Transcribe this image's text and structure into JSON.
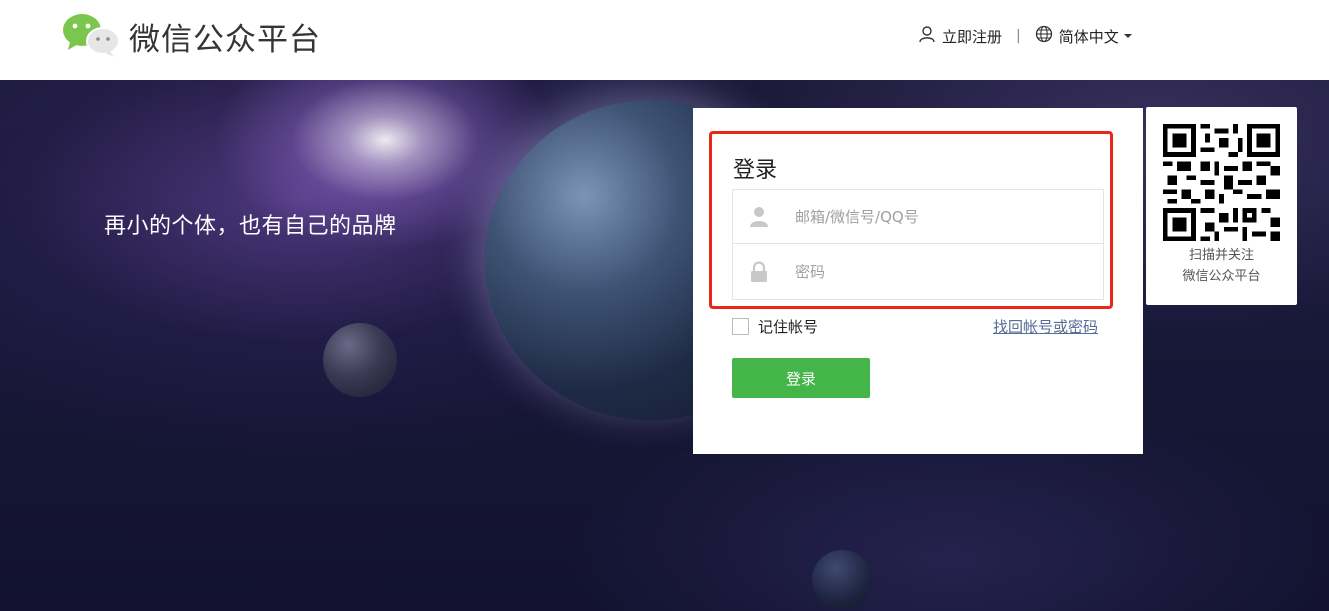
{
  "header": {
    "brand": "微信公众平台",
    "register_label": "立即注册",
    "separator": "|",
    "language_label": "简体中文"
  },
  "banner": {
    "slogan": "再小的个体，也有自己的品牌"
  },
  "login": {
    "title": "登录",
    "account_placeholder": "邮箱/微信号/QQ号",
    "password_placeholder": "密码",
    "remember_label": "记住帐号",
    "forgot_label": "找回帐号或密码",
    "submit_label": "登录",
    "highlight_color": "#e8261a",
    "button_color": "#44b549"
  },
  "qr": {
    "line1": "扫描并关注",
    "line2": "微信公众平台"
  },
  "icons": {
    "logo": "wechat-logo",
    "register": "user-icon",
    "language": "globe-icon",
    "account_field": "user-icon",
    "password_field": "lock-icon"
  }
}
